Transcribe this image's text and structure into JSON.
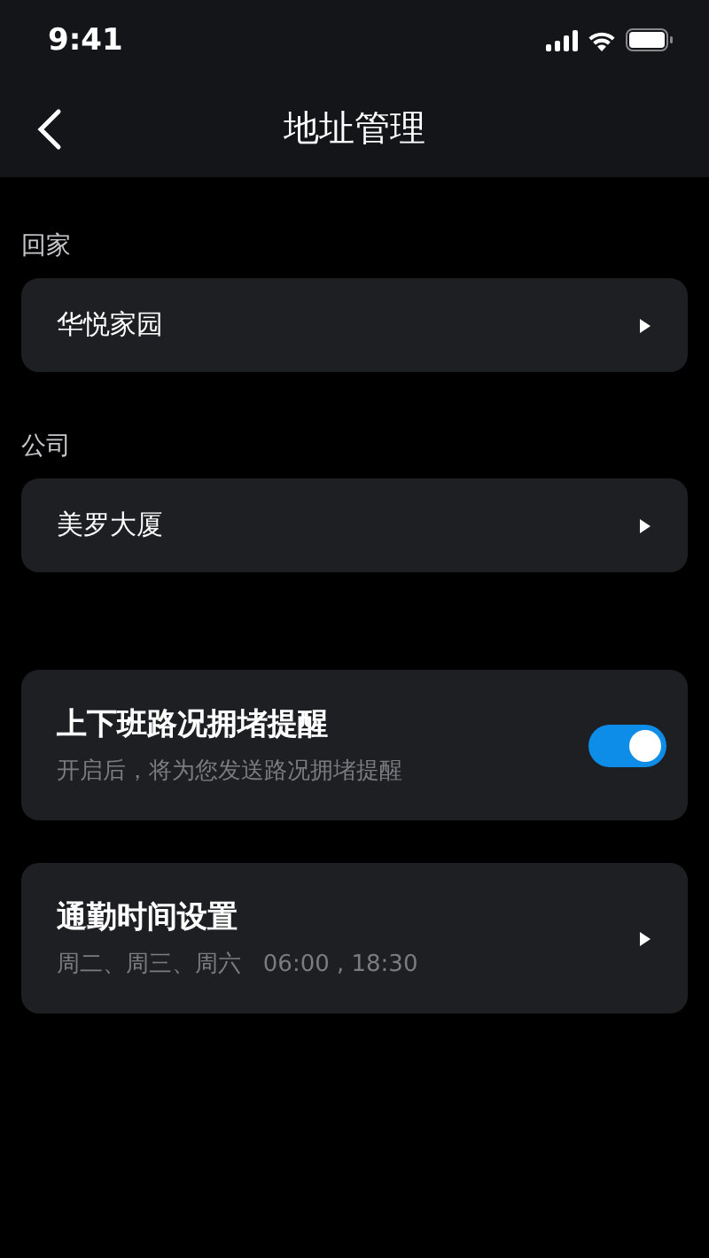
{
  "status_bar": {
    "time": "9:41"
  },
  "nav": {
    "title": "地址管理"
  },
  "address_groups": [
    {
      "label": "回家",
      "value": "华悦家园"
    },
    {
      "label": "公司",
      "value": "美罗大厦"
    }
  ],
  "settings": [
    {
      "kind": "toggle",
      "title": "上下班路况拥堵提醒",
      "subtitle": "开启后，将为您发送路况拥堵提醒",
      "on": true
    },
    {
      "kind": "link",
      "title": "通勤时间设置",
      "subtitle": "周二、周三、周六   06:00 , 18:30"
    }
  ]
}
